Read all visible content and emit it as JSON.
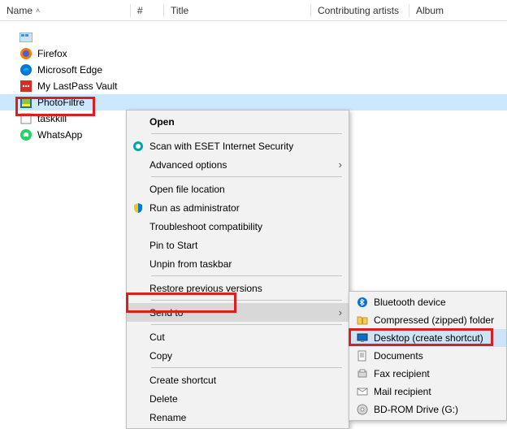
{
  "header": {
    "name": "Name",
    "number": "#",
    "title": "Title",
    "artists": "Contributing artists",
    "album": "Album"
  },
  "files": [
    {
      "name": "",
      "icon": "apps"
    },
    {
      "name": "Firefox",
      "icon": "firefox"
    },
    {
      "name": "Microsoft Edge",
      "icon": "edge"
    },
    {
      "name": "My LastPass Vault",
      "icon": "lastpass"
    },
    {
      "name": "PhotoFiltre",
      "icon": "photofiltre",
      "selected": true
    },
    {
      "name": "taskkill",
      "icon": "taskkill"
    },
    {
      "name": "WhatsApp",
      "icon": "whatsapp"
    }
  ],
  "menu": {
    "open": "Open",
    "scan": "Scan with ESET Internet Security",
    "advanced": "Advanced options",
    "openloc": "Open file location",
    "runadmin": "Run as administrator",
    "troubleshoot": "Troubleshoot compatibility",
    "pin": "Pin to Start",
    "unpin": "Unpin from taskbar",
    "restore": "Restore previous versions",
    "sendto": "Send to",
    "cut": "Cut",
    "copy": "Copy",
    "shortcut": "Create shortcut",
    "delete": "Delete",
    "rename": "Rename"
  },
  "submenu": {
    "bluetooth": "Bluetooth device",
    "compressed": "Compressed (zipped) folder",
    "desktop": "Desktop (create shortcut)",
    "documents": "Documents",
    "fax": "Fax recipient",
    "mail": "Mail recipient",
    "bdrom": "BD-ROM Drive (G:)"
  }
}
